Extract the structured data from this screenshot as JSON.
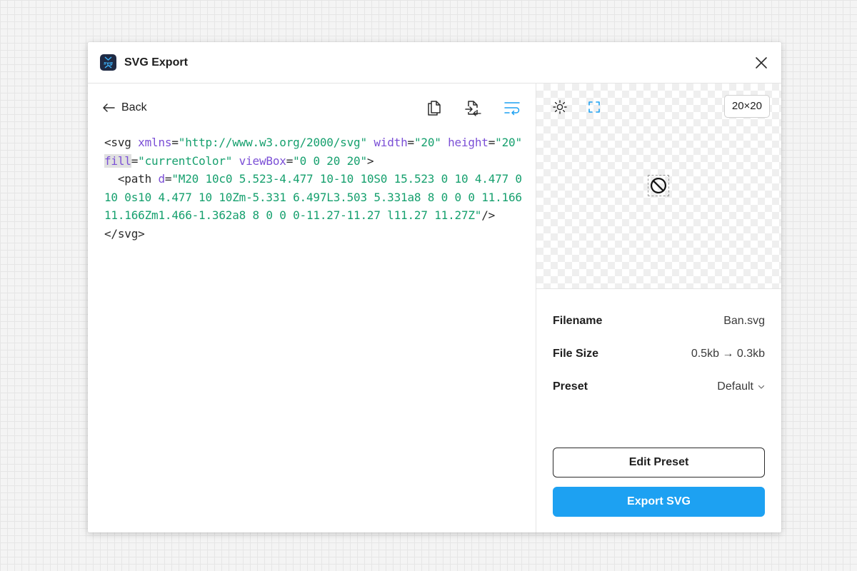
{
  "window": {
    "title": "SVG Export",
    "logo_icon": "svg-app-logo"
  },
  "left": {
    "back_label": "Back",
    "tools": [
      "copy-icon",
      "insert-icon",
      "wrap-text-icon"
    ],
    "accent_color": "#1da1f2",
    "code": [
      {
        "t": "tag",
        "v": "<svg "
      },
      {
        "t": "attr",
        "v": "xmlns"
      },
      {
        "t": "eq",
        "v": "="
      },
      {
        "t": "val",
        "v": "\"http://www.w3.org/2000/svg\""
      },
      {
        "t": "tag",
        "v": " "
      },
      {
        "t": "attr",
        "v": "width"
      },
      {
        "t": "eq",
        "v": "="
      },
      {
        "t": "val",
        "v": "\"20\""
      },
      {
        "t": "tag",
        "v": " "
      },
      {
        "t": "attr",
        "v": "height"
      },
      {
        "t": "eq",
        "v": "="
      },
      {
        "t": "val",
        "v": "\"20\""
      },
      {
        "t": "tag",
        "v": " "
      },
      {
        "t": "attr-hl",
        "v": "fill"
      },
      {
        "t": "eq",
        "v": "="
      },
      {
        "t": "val",
        "v": "\"currentColor\""
      },
      {
        "t": "tag",
        "v": " "
      },
      {
        "t": "attr",
        "v": "viewBox"
      },
      {
        "t": "eq",
        "v": "="
      },
      {
        "t": "val",
        "v": "\"0 0 20 20\""
      },
      {
        "t": "tag",
        "v": ">\n  <path "
      },
      {
        "t": "attr",
        "v": "d"
      },
      {
        "t": "eq",
        "v": "="
      },
      {
        "t": "val",
        "v": "\"M20 10c0 5.523-4.477 10-10 10S0 15.523 0 10 4.477 0 10 0s10 4.477 10 10Zm-5.331 6.497L3.503 5.331a8 8 0 0 0 11.166 11.166Zm1.466-1.362a8 8 0 0 0-11.27-11.27 l11.27 11.27Z\""
      },
      {
        "t": "tag",
        "v": "/>\n</svg>"
      }
    ]
  },
  "right": {
    "preview": {
      "tools": [
        "brightness-icon",
        "fit-frame-icon"
      ],
      "size_label": "20×20",
      "icon": "ban-icon"
    },
    "meta": {
      "filename_label": "Filename",
      "filename_value": "Ban.svg",
      "filesize_label": "File Size",
      "filesize_value": "0.5kb → 0.3kb",
      "preset_label": "Preset",
      "preset_value": "Default"
    },
    "edit_preset_label": "Edit Preset",
    "export_label": "Export SVG",
    "export_color": "#1da1f2"
  }
}
